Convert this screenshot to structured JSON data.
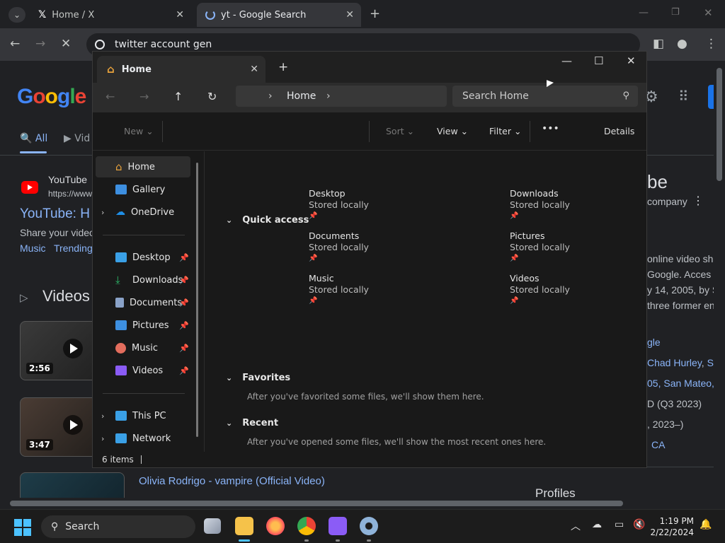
{
  "chrome": {
    "tabs": [
      {
        "label": "Home / X"
      },
      {
        "label": "yt - Google Search"
      }
    ],
    "address": "twitter account gen"
  },
  "google": {
    "logo_text": "Google",
    "nav": [
      {
        "label": "All"
      },
      {
        "label": "Vid"
      }
    ],
    "result": {
      "site": "YouTube",
      "url": "https://www",
      "title": "YouTube: H",
      "snippet": "Share your video",
      "links": [
        "Music",
        "Trending"
      ]
    },
    "videos_heading": "Videos",
    "videos": [
      {
        "duration": "2:56"
      },
      {
        "duration": "3:47"
      }
    ],
    "video_title": "Olivia Rodrigo - vampire (Official Video)",
    "panel": {
      "title_fragment": "be",
      "subtitle": "company",
      "lines": [
        "online video sha",
        "Google. Acces",
        "y 14, 2005, by S",
        "three former en"
      ],
      "founders_link": "gle",
      "founders": [
        "Chad Hurley",
        "Ste"
      ],
      "founded": "05, San Mateo,",
      "revenue": "D (Q3 2023)",
      "years": ", 2023–)",
      "hq": "CA",
      "profiles": "Profiles"
    }
  },
  "explorer": {
    "tab_title": "Home",
    "breadcrumb": "Home",
    "search_placeholder": "Search Home",
    "commands": {
      "new": "New",
      "sort": "Sort",
      "view": "View",
      "filter": "Filter",
      "more": "•••",
      "details": "Details"
    },
    "sidebar": {
      "top": [
        {
          "label": "Home",
          "icon": "home-icon",
          "color": "#e8a23c"
        },
        {
          "label": "Gallery",
          "icon": "gallery-icon",
          "color": "#3d8fe0"
        },
        {
          "label": "OneDrive",
          "icon": "cloud-icon",
          "color": "#1f8ee6"
        }
      ],
      "pinned": [
        {
          "label": "Desktop",
          "icon": "desktop-folder-icon",
          "color": "#3aa0e6"
        },
        {
          "label": "Downloads",
          "icon": "download-icon",
          "color": "#2ebd6c"
        },
        {
          "label": "Documents",
          "icon": "documents-icon",
          "color": "#8aa2c8"
        },
        {
          "label": "Pictures",
          "icon": "pictures-icon",
          "color": "#3d8fe0"
        },
        {
          "label": "Music",
          "icon": "music-icon",
          "color": "#e36d5d"
        },
        {
          "label": "Videos",
          "icon": "videos-icon",
          "color": "#8b5cf6"
        }
      ],
      "bottom": [
        {
          "label": "This PC",
          "icon": "pc-icon",
          "color": "#3aa0e6"
        },
        {
          "label": "Network",
          "icon": "network-icon",
          "color": "#3aa0e6"
        }
      ]
    },
    "sections": {
      "quick_access": "Quick access",
      "favorites": "Favorites",
      "favorites_note": "After you've favorited some files, we'll show them here.",
      "recent": "Recent",
      "recent_note": "After you've opened some files, we'll show the most recent ones here."
    },
    "quick_access": [
      {
        "name": "Desktop",
        "status": "Stored locally"
      },
      {
        "name": "Downloads",
        "status": "Stored locally"
      },
      {
        "name": "Documents",
        "status": "Stored locally"
      },
      {
        "name": "Pictures",
        "status": "Stored locally"
      },
      {
        "name": "Music",
        "status": "Stored locally"
      },
      {
        "name": "Videos",
        "status": "Stored locally"
      }
    ],
    "status": "6 items"
  },
  "taskbar": {
    "search_label": "Search",
    "time": "1:19 PM",
    "date": "2/22/2024"
  },
  "colors": {
    "accent": "#4cc2ff",
    "link": "#8ab4f8"
  }
}
